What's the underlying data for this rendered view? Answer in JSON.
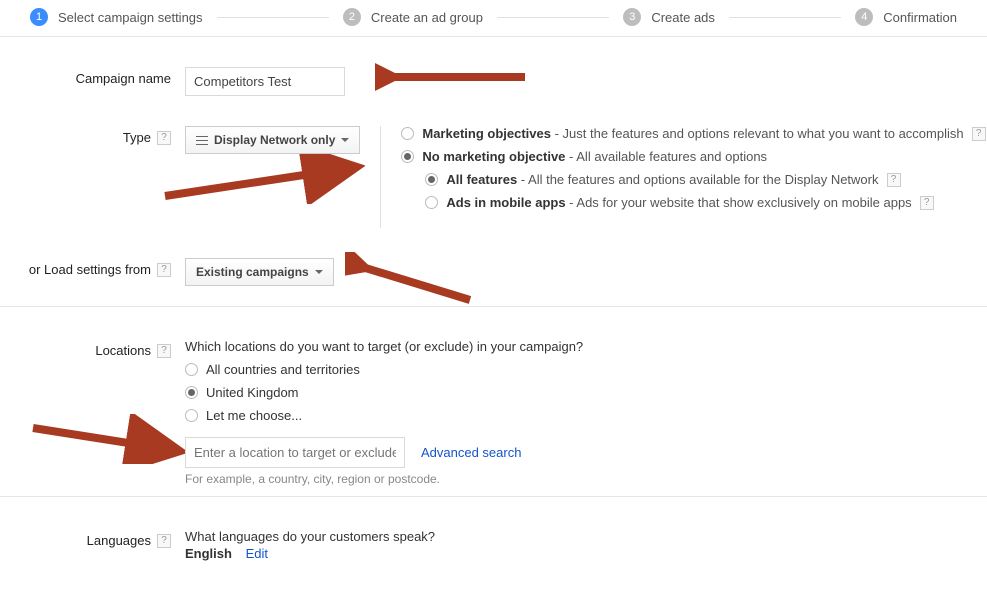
{
  "stepper": {
    "steps": [
      {
        "num": "1",
        "label": "Select campaign settings",
        "active": true
      },
      {
        "num": "2",
        "label": "Create an ad group",
        "active": false
      },
      {
        "num": "3",
        "label": "Create ads",
        "active": false
      },
      {
        "num": "4",
        "label": "Confirmation",
        "active": false
      }
    ]
  },
  "campaign_name": {
    "label": "Campaign name",
    "value": "Competitors Test"
  },
  "type": {
    "label": "Type",
    "dropdown": "Display Network only",
    "options": {
      "marketing_label": "Marketing objectives",
      "marketing_desc": " - Just the features and options relevant to what you want to accomplish",
      "no_marketing_label": "No marketing objective",
      "no_marketing_desc": " - All available features and options",
      "all_features_label": "All features",
      "all_features_desc": " - All the features and options available for the Display Network",
      "mobile_label": "Ads in mobile apps",
      "mobile_desc": " - Ads for your website that show exclusively on mobile apps"
    }
  },
  "load_settings": {
    "label": "or Load settings from",
    "dropdown": "Existing campaigns"
  },
  "locations": {
    "label": "Locations",
    "prompt": "Which locations do you want to target (or exclude) in your campaign?",
    "opt_all": "All countries and territories",
    "opt_uk": "United Kingdom",
    "opt_choose": "Let me choose...",
    "placeholder": "Enter a location to target or exclude.",
    "advanced": "Advanced search",
    "hint": "For example, a country, city, region or postcode."
  },
  "languages": {
    "label": "Languages",
    "prompt": "What languages do your customers speak?",
    "value": "English",
    "edit": "Edit"
  },
  "help_glyph": "?",
  "arrow_color": "#a83a22"
}
